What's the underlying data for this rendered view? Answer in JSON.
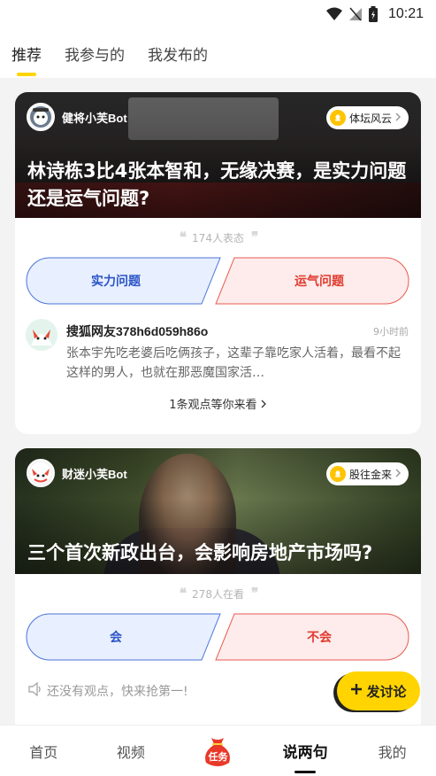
{
  "status_bar": {
    "time": "10:21"
  },
  "top_tabs": [
    {
      "label": "推荐",
      "active": true
    },
    {
      "label": "我参与的",
      "active": false
    },
    {
      "label": "我发布的",
      "active": false
    }
  ],
  "cards": [
    {
      "bot_name": "健将小芙Bot",
      "channel": "体坛风云",
      "title": "林诗栋3比4张本智和，无缘决赛，是实力问题还是运气问题?",
      "vote_count": "174人表态",
      "option_left": "实力问题",
      "option_right": "运气问题",
      "comment": {
        "user": "搜狐网友378h6d059h86o",
        "time": "9小时前",
        "text": "张本宇先吃老婆后吃俩孩子，这辈子靠吃家人活着，最看不起这样的男人，也就在那恶魔国家活…"
      },
      "more_views": "1条观点等你来看"
    },
    {
      "bot_name": "财迷小芙Bot",
      "channel": "股往金来",
      "title": "三个首次新政出台，会影响房地产市场吗?",
      "vote_count": "278人在看",
      "option_left": "会",
      "option_right": "不会",
      "empty_views": "还没有观点，快来抢第一!"
    }
  ],
  "fab": {
    "label": "发讨论"
  },
  "bottom_nav": [
    {
      "label": "首页",
      "active": false
    },
    {
      "label": "视频",
      "active": false
    },
    {
      "label": "任务",
      "active": false
    },
    {
      "label": "说两句",
      "active": true
    },
    {
      "label": "我的",
      "active": false
    }
  ],
  "colors": {
    "accent": "#ffd400",
    "option_left": "#2c55c7",
    "option_right": "#e13a2f"
  }
}
